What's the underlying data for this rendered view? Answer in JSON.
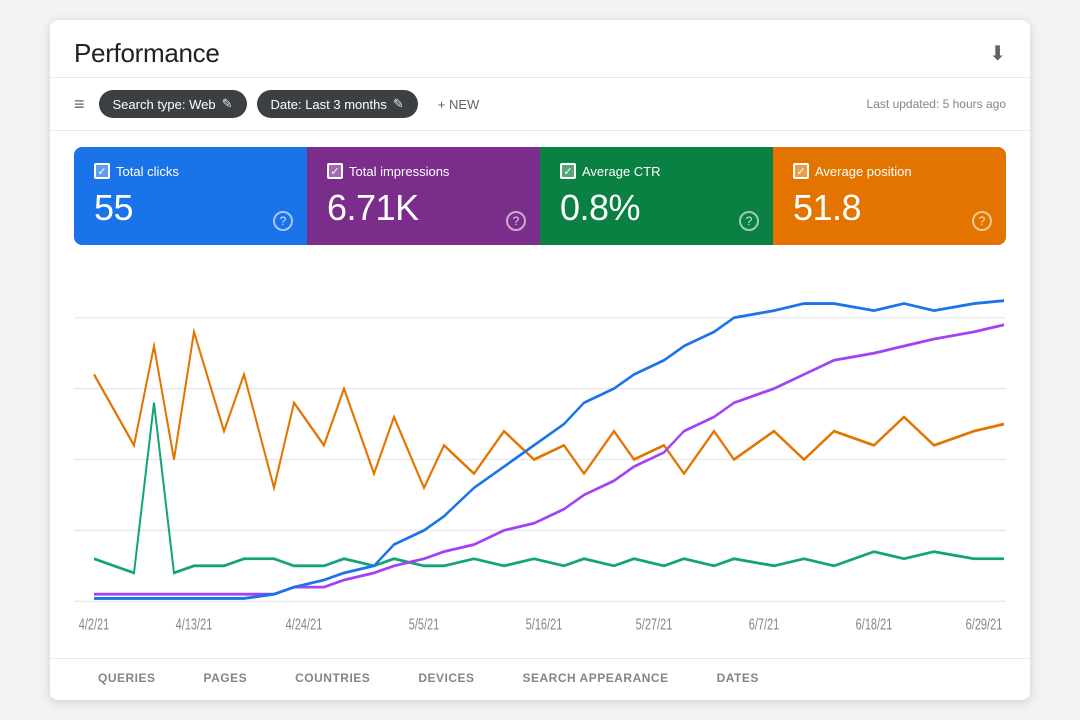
{
  "header": {
    "title": "Performance",
    "download_icon": "⬇"
  },
  "toolbar": {
    "filter_icon": "≡",
    "search_type_chip": "Search type: Web",
    "date_chip": "Date: Last 3 months",
    "edit_icon": "✎",
    "new_button": "+ NEW",
    "last_updated": "Last updated: 5 hours ago"
  },
  "metrics": [
    {
      "id": "total-clicks",
      "label": "Total clicks",
      "value": "55",
      "color": "blue",
      "bg": "#1a73e8"
    },
    {
      "id": "total-impressions",
      "label": "Total impressions",
      "value": "6.71K",
      "color": "purple",
      "bg": "#7b2d8b"
    },
    {
      "id": "average-ctr",
      "label": "Average CTR",
      "value": "0.8%",
      "color": "teal",
      "bg": "#0b8043"
    },
    {
      "id": "average-position",
      "label": "Average position",
      "value": "51.8",
      "color": "orange",
      "bg": "#e37400"
    }
  ],
  "chart": {
    "x_labels": [
      "4/2/21",
      "4/13/21",
      "4/24/21",
      "5/5/21",
      "5/16/21",
      "5/27/21",
      "6/7/21",
      "6/18/21",
      "6/29/21"
    ],
    "series": [
      {
        "name": "Total clicks",
        "color": "#1a73e8"
      },
      {
        "name": "Total impressions",
        "color": "#a142f4"
      },
      {
        "name": "Average CTR",
        "color": "#12a37a"
      },
      {
        "name": "Average position",
        "color": "#e37400"
      }
    ]
  },
  "tabs": [
    {
      "label": "QUERIES",
      "active": false
    },
    {
      "label": "PAGES",
      "active": false
    },
    {
      "label": "COUNTRIES",
      "active": false
    },
    {
      "label": "DEVICES",
      "active": false
    },
    {
      "label": "SEARCH APPEARANCE",
      "active": false
    },
    {
      "label": "DATES",
      "active": false
    }
  ]
}
